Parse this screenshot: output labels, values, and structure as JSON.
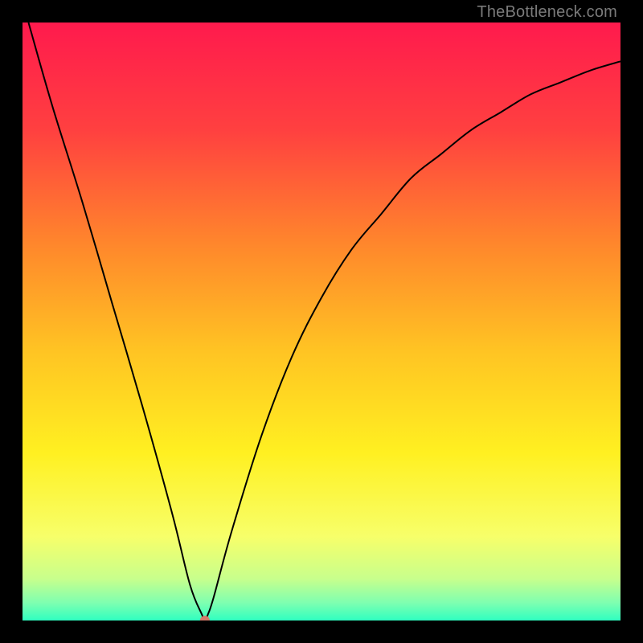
{
  "watermark": "TheBottleneck.com",
  "chart_data": {
    "type": "line",
    "title": "",
    "xlabel": "",
    "ylabel": "",
    "xlim": [
      0,
      100
    ],
    "ylim": [
      0,
      100
    ],
    "grid": false,
    "legend": false,
    "background_gradient": {
      "stops": [
        {
          "offset": 0.0,
          "color": "#ff1a4d"
        },
        {
          "offset": 0.18,
          "color": "#ff4040"
        },
        {
          "offset": 0.38,
          "color": "#ff8a2b"
        },
        {
          "offset": 0.55,
          "color": "#ffc423"
        },
        {
          "offset": 0.72,
          "color": "#fff021"
        },
        {
          "offset": 0.86,
          "color": "#f7ff6a"
        },
        {
          "offset": 0.93,
          "color": "#c8ff8c"
        },
        {
          "offset": 0.97,
          "color": "#7fffb0"
        },
        {
          "offset": 1.0,
          "color": "#2fffc0"
        }
      ]
    },
    "series": [
      {
        "name": "bottleneck-curve",
        "stroke": "#000000",
        "stroke_width": 2,
        "x": [
          1,
          5,
          10,
          15,
          20,
          25,
          28,
          30,
          30.5,
          31,
          32,
          35,
          40,
          45,
          50,
          55,
          60,
          65,
          70,
          75,
          80,
          85,
          90,
          95,
          100
        ],
        "y": [
          100,
          86,
          70,
          53,
          36,
          18,
          6,
          1,
          0,
          1,
          4,
          15,
          31,
          44,
          54,
          62,
          68,
          74,
          78,
          82,
          85,
          88,
          90,
          92,
          93.5
        ]
      }
    ],
    "marker": {
      "name": "optimal-point",
      "x": 30.5,
      "y": 0,
      "color": "#d47a6a",
      "radius": 6
    }
  }
}
